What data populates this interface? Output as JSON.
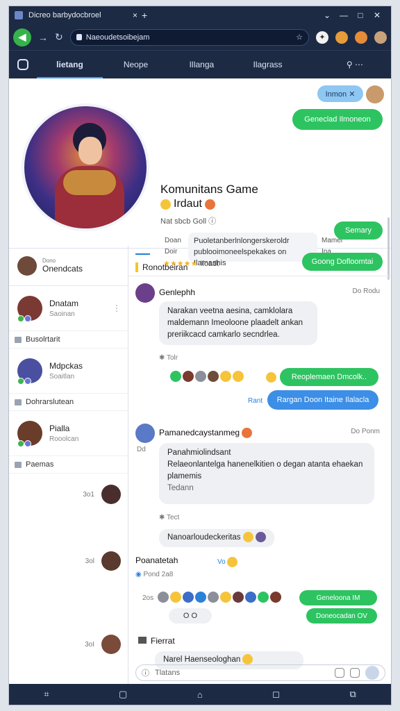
{
  "window": {
    "tab_title": "Dicreo barbydocbroel",
    "close": "×",
    "new_tab": "+",
    "controls": [
      "⌄",
      "—",
      "□",
      "✕"
    ]
  },
  "addressbar": {
    "back": "◀",
    "forward": "→",
    "reload": "↻",
    "url": "Naeoudetsoibejam"
  },
  "appnav": {
    "tabs": [
      "lietang",
      "Neope",
      "lIlanga",
      "Ilagrass"
    ],
    "search": "⚲  ⋯"
  },
  "header": {
    "top_pill": "Inmon  ✕",
    "join_button": "Geneclad Ilmoneon",
    "title": "Komunitans Game",
    "subtitle": "Irdaut",
    "small": "Nat sbcb Goll ⓘ",
    "left_labels": [
      "Doan",
      "Doir"
    ],
    "description": "Puoletanberlnlongerskeroldr\npublooimoneelspekakes on Ilamashis",
    "right_labels": [
      "Mamel",
      "Ina"
    ],
    "stars": "★★★★★",
    "stars_text": "Iloadt",
    "bottom_pill": "Semary"
  },
  "sidebar": {
    "head_title": "Onendcats",
    "head_top": "Dono",
    "items": [
      {
        "name": "Dnatam",
        "sub": "Saoinan",
        "row": "Busolrtarit"
      },
      {
        "name": "Mdpckas",
        "sub": "Soaitlan",
        "row": "Dohrarslutean"
      },
      {
        "name": "Pialla",
        "sub": "Rooolcan",
        "row": "Paemas"
      }
    ],
    "dots": [
      "3o1",
      "3ol",
      "3oI"
    ]
  },
  "main": {
    "marker": "▬▬▬",
    "header_label": "Ronotbeiran",
    "header_button": "Goong Dofloomtai",
    "m1": {
      "name": "Genlephh",
      "time": "Do Rodu",
      "text": "Narakan veetna aesina, camklolara\nmaldemann Imeoloone plaadelt ankan\npreriikcacd camkarlo secndrlea.",
      "sub": "Tolr"
    },
    "reply_green": "Reoplemaen Dmcolk..",
    "reply_blue": "Rargan Doon Itaine Ilalacla",
    "reply_blue_label": "Rant",
    "m2": {
      "name": "Pamanedcaystanmeg",
      "time": "Do Ponm",
      "avatar_label": "Dd",
      "text": "Panahmiolindsant\nRelaeonlantelga hanenelkitien o degan atanta ehaekan\nplamemis",
      "sub": "Tedann",
      "time2": "Tect"
    },
    "quote": "Nanoarloudeckeritas",
    "m3": {
      "name": "Poanatetah",
      "time": "Pond 2a8",
      "tag": "Vo"
    },
    "counter": "2os",
    "btn_a": "Geneloona  IM",
    "btn_b": "Doneocadan  OV",
    "toggle": "O  O",
    "m4": {
      "name": "Fierrat",
      "text": "Narel Haenseologhan"
    },
    "composer_placeholder": "Tlatans"
  },
  "bottomnav": [
    "⌗",
    "▢",
    "⌂",
    "◻",
    "⧉"
  ]
}
